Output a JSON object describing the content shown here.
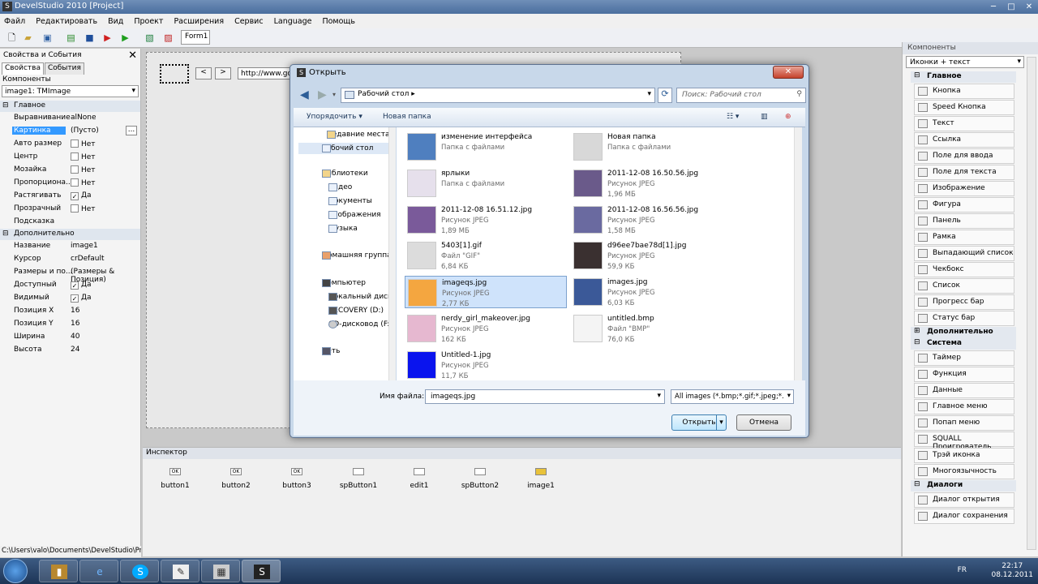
{
  "window": {
    "title": "DevelStudio 2010 [Project]"
  },
  "menu": [
    "Файл",
    "Редактировать",
    "Вид",
    "Проект",
    "Расширения",
    "Сервис",
    "Language",
    "Помощь"
  ],
  "form_tab": "Form1",
  "left_panel": {
    "title": "Свойства и События",
    "tabs": [
      "Свойства",
      "События"
    ],
    "components_label": "Компоненты",
    "selected_component": "image1: TMImage",
    "section_main": "Главное",
    "props_main": [
      {
        "name": "Выравнивание",
        "value": "alNone"
      },
      {
        "name": "Картинка",
        "value": "(Пусто)"
      },
      {
        "name": "Авто размер",
        "value": "Нет"
      },
      {
        "name": "Центр",
        "value": "Нет"
      },
      {
        "name": "Мозайка",
        "value": "Нет"
      },
      {
        "name": "Пропорциона...",
        "value": "Нет"
      },
      {
        "name": "Растягивать",
        "value": "Да"
      },
      {
        "name": "Прозрачный",
        "value": "Нет"
      },
      {
        "name": "Подсказка",
        "value": ""
      }
    ],
    "section_extra": "Дополнительно",
    "props_extra": [
      {
        "name": "Название",
        "value": "image1"
      },
      {
        "name": "Курсор",
        "value": "crDefault"
      },
      {
        "name": "Размеры и по...",
        "value": "(Размеры & Позиция)"
      },
      {
        "name": "Доступный",
        "value": "Да"
      },
      {
        "name": "Видимый",
        "value": "Да"
      },
      {
        "name": "Позиция X",
        "value": "16"
      },
      {
        "name": "Позиция Y",
        "value": "16"
      },
      {
        "name": "Ширина",
        "value": "40"
      },
      {
        "name": "Высота",
        "value": "24"
      }
    ],
    "path": "C:\\Users\\valo\\Documents\\DevelStudio\\Projec"
  },
  "design": {
    "url_text": "http://www.go"
  },
  "inspector": {
    "title": "Инспектор",
    "items": [
      "button1",
      "button2",
      "button3",
      "spButton1",
      "edit1",
      "spButton2",
      "image1"
    ]
  },
  "right_panel": {
    "title": "Компоненты",
    "view_mode": "Иконки + текст",
    "sections": [
      {
        "name": "Главное",
        "items": [
          "Кнопка",
          "Speed Кнопка",
          "Текст",
          "Ссылка",
          "Поле для ввода",
          "Поле для текста",
          "Изображение",
          "Фигура",
          "Панель",
          "Рамка",
          "Выпадающий список",
          "Чекбокс",
          "Список",
          "Прогресс бар",
          "Статус бар"
        ]
      },
      {
        "name": "Дополнительно",
        "items": []
      },
      {
        "name": "Система",
        "items": [
          "Таймер",
          "Функция",
          "Данные",
          "Главное меню",
          "Попап меню",
          "SQUALL Проигрователь",
          "Трэй иконка",
          "Многоязычность"
        ]
      },
      {
        "name": "Диалоги",
        "items": [
          "Диалог открытия",
          "Диалог сохранения"
        ]
      }
    ]
  },
  "dialog": {
    "title": "Открыть",
    "address": "Рабочий стол",
    "search_placeholder": "Поиск: Рабочий стол",
    "organize": "Упорядочить",
    "new_folder": "Новая папка",
    "nav": {
      "fav": [
        "Недавние места",
        "Рабочий стол"
      ],
      "libraries": "Библиотеки",
      "lib_items": [
        "Видео",
        "Документы",
        "Изображения",
        "Музыка"
      ],
      "homegroup": "Домашняя группа",
      "computer": "Компьютер",
      "drives": [
        "Локальный диск",
        "RECOVERY (D:)",
        "CD-дисковод (F:"
      ],
      "network": "Сеть"
    },
    "files": [
      {
        "name": "изменение интерфейса",
        "type": "Папка с файлами",
        "size": ""
      },
      {
        "name": "Новая папка",
        "type": "Папка с файлами",
        "size": ""
      },
      {
        "name": "ярлыки",
        "type": "Папка с файлами",
        "size": ""
      },
      {
        "name": "2011-12-08 16.50.56.jpg",
        "type": "Рисунок JPEG",
        "size": "1,96 МБ"
      },
      {
        "name": "2011-12-08 16.51.12.jpg",
        "type": "Рисунок JPEG",
        "size": "1,89 МБ"
      },
      {
        "name": "2011-12-08 16.56.56.jpg",
        "type": "Рисунок JPEG",
        "size": "1,58 МБ"
      },
      {
        "name": "5403[1].gif",
        "type": "Файл \"GIF\"",
        "size": "6,84 КБ"
      },
      {
        "name": "d96ee7bae78d[1].jpg",
        "type": "Рисунок JPEG",
        "size": "59,9 КБ"
      },
      {
        "name": "imageqs.jpg",
        "type": "Рисунок JPEG",
        "size": "2,77 КБ"
      },
      {
        "name": "images.jpg",
        "type": "Рисунок JPEG",
        "size": "6,03 КБ"
      },
      {
        "name": "nerdy_girl_makeover.jpg",
        "type": "Рисунок JPEG",
        "size": "162 КБ"
      },
      {
        "name": "untitled.bmp",
        "type": "Файл \"BMP\"",
        "size": "76,0 КБ"
      },
      {
        "name": "Untitled-1.jpg",
        "type": "Рисунок JPEG",
        "size": "11,7 КБ"
      }
    ],
    "filename_label": "Имя файла:",
    "filename_value": "imageqs.jpg",
    "filetype": "All images (*.bmp;*.gif;*.jpeg;*.",
    "open_btn": "Открыть",
    "cancel_btn": "Отмена"
  },
  "taskbar": {
    "lang": "FR",
    "time": "22:17",
    "date": "08.12.2011"
  }
}
